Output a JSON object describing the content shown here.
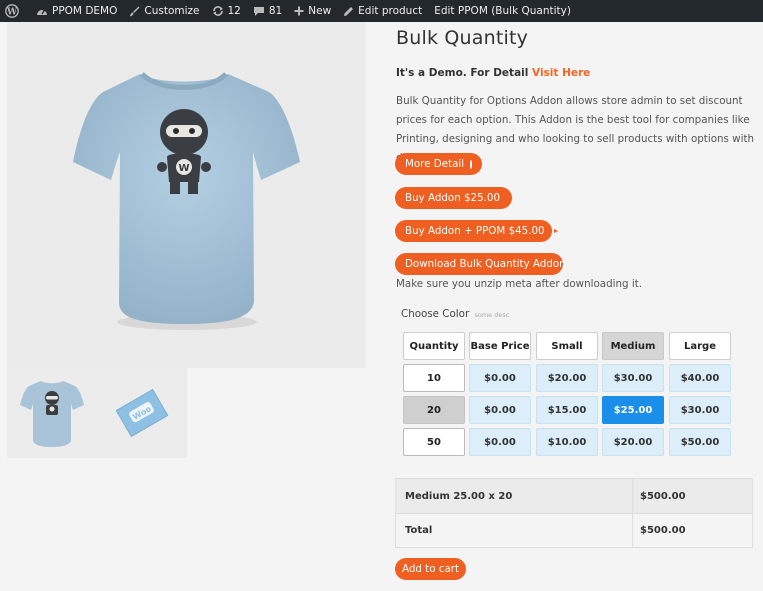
{
  "adminbar": {
    "site_name": "PPOM DEMO",
    "customize": "Customize",
    "updates_count": "12",
    "comments_count": "81",
    "new_label": "New",
    "edit_product": "Edit product",
    "edit_ppom": "Edit PPOM (Bulk Quantity)"
  },
  "product": {
    "title": "Bulk Quantity",
    "demo_note": "It's a Demo. For Detail",
    "visit_link": "Visit Here",
    "description": "Bulk Quantity for Options Addon allows store admin to set discount prices for each option. This Addon is the best tool for companies like Printing, designing and who looking to sell products with options with different prices.",
    "buttons": {
      "more_detail": "More Detail",
      "buy_addon": "Buy Addon $25.00",
      "buy_addon_ppom": "Buy Addon + PPOM $45.00",
      "download": "Download Bulk Quantity Addon"
    },
    "unzip_note": "Make sure you unzip meta after downloading it.",
    "thumb2_label": "Woo"
  },
  "matrix": {
    "label": "Choose Color",
    "desc": "some desc",
    "headers": [
      "Quantity",
      "Base Price",
      "Small",
      "Medium",
      "Large"
    ],
    "selected_header": "Medium",
    "rows": [
      {
        "qty": "10",
        "prices": [
          "$0.00",
          "$20.00",
          "$30.00",
          "$40.00"
        ]
      },
      {
        "qty": "20",
        "prices": [
          "$0.00",
          "$15.00",
          "$25.00",
          "$30.00"
        ]
      },
      {
        "qty": "50",
        "prices": [
          "$0.00",
          "$10.00",
          "$20.00",
          "$50.00"
        ]
      }
    ],
    "selected": {
      "qty": "20",
      "price": "$25.00"
    }
  },
  "totals": {
    "line_label": "Medium 25.00 x 20",
    "line_value": "$500.00",
    "total_label": "Total",
    "total_value": "$500.00"
  },
  "cart": {
    "add_label": "Add to cart"
  },
  "colors": {
    "accent": "#f05f22",
    "selected_blue": "#1a8ee8",
    "price_cell": "#dbeef9",
    "shirt": "#a8c4d8"
  }
}
